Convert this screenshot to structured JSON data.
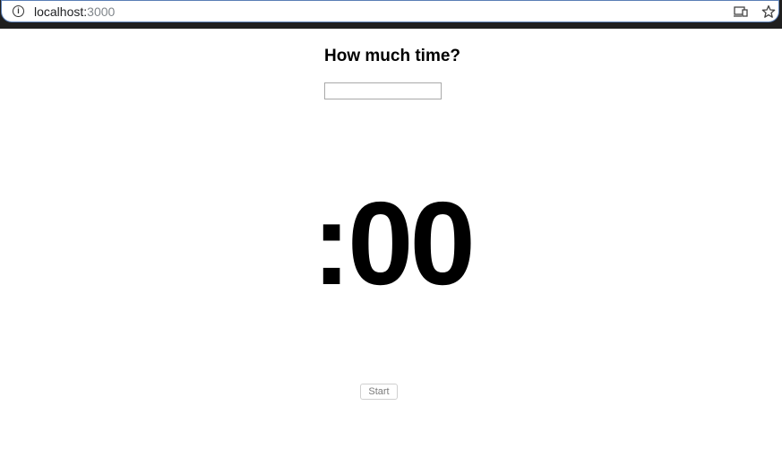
{
  "browser": {
    "url_host": "localhost:",
    "url_port": "3000",
    "icons": [
      "info-icon",
      "cast-icon",
      "star-icon"
    ]
  },
  "main": {
    "heading": "How much time?",
    "time_input": {
      "value": "",
      "placeholder": ""
    },
    "timer_display": ":00",
    "start_button_label": "Start"
  }
}
